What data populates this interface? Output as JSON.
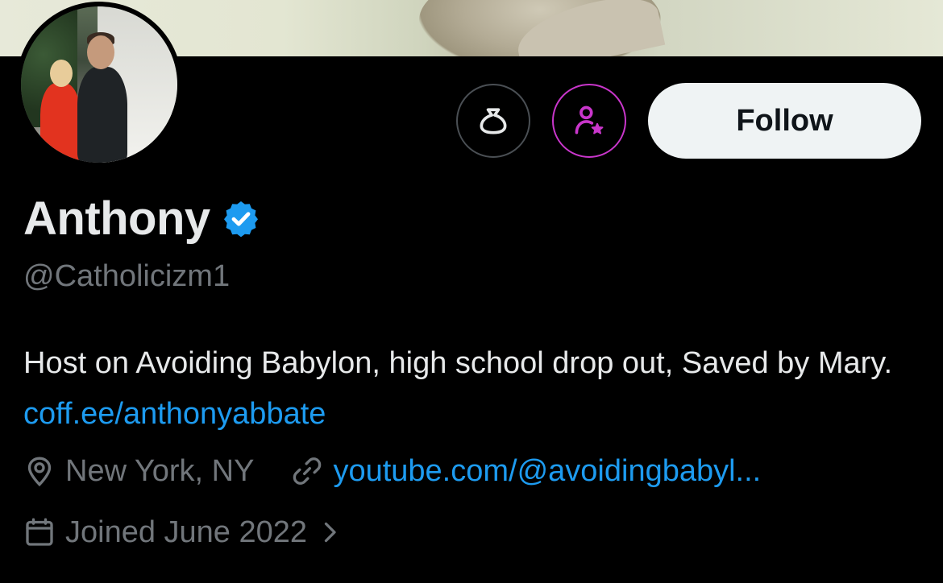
{
  "profile": {
    "display_name": "Anthony",
    "handle": "@Catholicizm1",
    "verified": true,
    "bio_text": "Host on Avoiding Babylon, high school drop out, Saved by Mary.",
    "bio_link": "coff.ee/anthonyabbate",
    "location": "New York, NY",
    "website": "youtube.com/@avoidingbabyl...",
    "joined": "Joined June 2022"
  },
  "actions": {
    "subscribe_icon": "money-bag-icon",
    "grok_icon": "person-star-icon",
    "follow_label": "Follow"
  },
  "colors": {
    "background": "#000000",
    "primary_text": "#e7e9ea",
    "secondary_text": "#71767b",
    "link": "#1d9bf0",
    "verified": "#1d9bf0",
    "grok_accent": "#c936cb",
    "follow_bg": "#eff3f4"
  }
}
